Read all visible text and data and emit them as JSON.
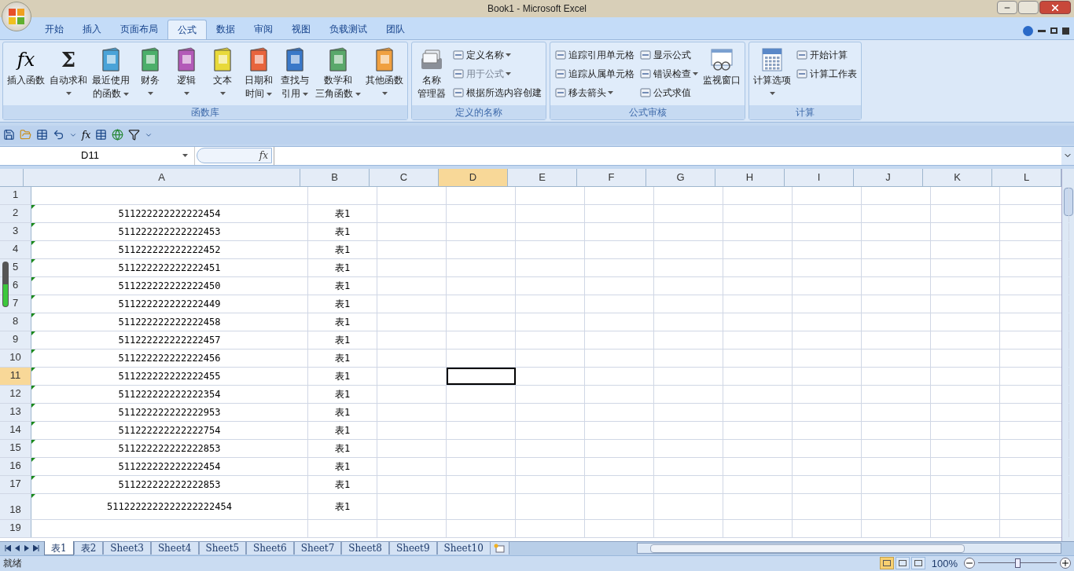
{
  "window": {
    "title": "Book1 - Microsoft Excel"
  },
  "tabs": [
    {
      "label": "开始",
      "selected": false
    },
    {
      "label": "插入",
      "selected": false
    },
    {
      "label": "页面布局",
      "selected": false
    },
    {
      "label": "公式",
      "selected": true
    },
    {
      "label": "数据",
      "selected": false
    },
    {
      "label": "审阅",
      "selected": false
    },
    {
      "label": "视图",
      "selected": false
    },
    {
      "label": "负载测试",
      "selected": false
    },
    {
      "label": "团队",
      "selected": false
    }
  ],
  "ribbon_groups": [
    {
      "label": "函数库",
      "items": [
        {
          "kind": "large",
          "glyph": "fx",
          "lines": [
            "插入函数"
          ],
          "dropdown": false
        },
        {
          "kind": "large",
          "glyph": "Σ",
          "lines": [
            "自动求和"
          ],
          "dropdown": true
        },
        {
          "kind": "large",
          "lines": [
            "最近使用",
            "的函数"
          ],
          "dropdown": true
        },
        {
          "kind": "large",
          "lines": [
            "财务"
          ],
          "dropdown": true
        },
        {
          "kind": "large",
          "lines": [
            "逻辑"
          ],
          "dropdown": true
        },
        {
          "kind": "large",
          "lines": [
            "文本"
          ],
          "dropdown": true
        },
        {
          "kind": "large",
          "lines": [
            "日期和",
            "时间"
          ],
          "dropdown": true
        },
        {
          "kind": "large",
          "lines": [
            "查找与",
            "引用"
          ],
          "dropdown": true
        },
        {
          "kind": "large",
          "lines": [
            "数学和",
            "三角函数"
          ],
          "dropdown": true
        },
        {
          "kind": "large",
          "lines": [
            "其他函数"
          ],
          "dropdown": true
        }
      ]
    },
    {
      "label": "定义的名称",
      "items": [
        {
          "kind": "large",
          "lines": [
            "名称",
            "管理器"
          ],
          "dropdown": false
        },
        {
          "kind": "stack",
          "entries": [
            {
              "label": "定义名称",
              "dropdown": true,
              "disabled": false
            },
            {
              "label": "用于公式",
              "dropdown": true,
              "disabled": true
            },
            {
              "label": "根据所选内容创建",
              "dropdown": false,
              "disabled": false
            }
          ]
        }
      ]
    },
    {
      "label": "公式审核",
      "items": [
        {
          "kind": "stack",
          "entries": [
            {
              "label": "追踪引用单元格",
              "dropdown": false,
              "disabled": false
            },
            {
              "label": "追踪从属单元格",
              "dropdown": false,
              "disabled": false
            },
            {
              "label": "移去箭头",
              "dropdown": true,
              "disabled": false
            }
          ]
        },
        {
          "kind": "stack",
          "entries": [
            {
              "label": "显示公式",
              "dropdown": false,
              "disabled": false
            },
            {
              "label": "错误检查",
              "dropdown": true,
              "disabled": false
            },
            {
              "label": "公式求值",
              "dropdown": false,
              "disabled": false
            }
          ]
        },
        {
          "kind": "large",
          "lines": [
            "监视窗口"
          ],
          "dropdown": false
        }
      ]
    },
    {
      "label": "计算",
      "items": [
        {
          "kind": "large",
          "lines": [
            "计算选项"
          ],
          "dropdown": true
        },
        {
          "kind": "stack",
          "entries": [
            {
              "label": "开始计算",
              "dropdown": false,
              "disabled": false
            },
            {
              "label": "计算工作表",
              "dropdown": false,
              "disabled": false
            }
          ]
        }
      ]
    }
  ],
  "name_box": {
    "value": "D11"
  },
  "quick_access": {
    "function_glyph": "fx"
  },
  "formula_bar": {
    "function_glyph": "fx"
  },
  "columns": [
    {
      "label": "A",
      "selected": false
    },
    {
      "label": "B",
      "selected": false
    },
    {
      "label": "C",
      "selected": false
    },
    {
      "label": "D",
      "selected": true
    },
    {
      "label": "E",
      "selected": false
    },
    {
      "label": "F",
      "selected": false
    },
    {
      "label": "G",
      "selected": false
    },
    {
      "label": "H",
      "selected": false
    },
    {
      "label": "I",
      "selected": false
    },
    {
      "label": "J",
      "selected": false
    },
    {
      "label": "K",
      "selected": false
    },
    {
      "label": "L",
      "selected": false
    }
  ],
  "rows": [
    {
      "label": "1",
      "selected": false,
      "error_flag": false,
      "cells": [
        "",
        ""
      ]
    },
    {
      "label": "2",
      "selected": false,
      "error_flag": true,
      "cells": [
        "511222222222222454",
        "表1"
      ]
    },
    {
      "label": "3",
      "selected": false,
      "error_flag": true,
      "cells": [
        "511222222222222453",
        "表1"
      ]
    },
    {
      "label": "4",
      "selected": false,
      "error_flag": true,
      "cells": [
        "511222222222222452",
        "表1"
      ]
    },
    {
      "label": "5",
      "selected": false,
      "error_flag": true,
      "cells": [
        "511222222222222451",
        "表1"
      ]
    },
    {
      "label": "6",
      "selected": false,
      "error_flag": true,
      "cells": [
        "511222222222222450",
        "表1"
      ]
    },
    {
      "label": "7",
      "selected": false,
      "error_flag": true,
      "cells": [
        "511222222222222449",
        "表1"
      ]
    },
    {
      "label": "8",
      "selected": false,
      "error_flag": true,
      "cells": [
        "511222222222222458",
        "表1"
      ]
    },
    {
      "label": "9",
      "selected": false,
      "error_flag": true,
      "cells": [
        "511222222222222457",
        "表1"
      ]
    },
    {
      "label": "10",
      "selected": false,
      "error_flag": true,
      "cells": [
        "511222222222222456",
        "表1"
      ]
    },
    {
      "label": "11",
      "selected": true,
      "error_flag": true,
      "cells": [
        "511222222222222455",
        "表1"
      ]
    },
    {
      "label": "12",
      "selected": false,
      "error_flag": true,
      "cells": [
        "511222222222222354",
        "表1"
      ]
    },
    {
      "label": "13",
      "selected": false,
      "error_flag": true,
      "cells": [
        "511222222222222953",
        "表1"
      ]
    },
    {
      "label": "14",
      "selected": false,
      "error_flag": true,
      "cells": [
        "511222222222222754",
        "表1"
      ]
    },
    {
      "label": "15",
      "selected": false,
      "error_flag": true,
      "cells": [
        "511222222222222853",
        "表1"
      ]
    },
    {
      "label": "16",
      "selected": false,
      "error_flag": true,
      "cells": [
        "511222222222222454",
        "表1"
      ]
    },
    {
      "label": "17",
      "selected": false,
      "error_flag": true,
      "cells": [
        "511222222222222853",
        "表1"
      ]
    },
    {
      "label": "18",
      "selected": false,
      "error_flag": true,
      "tall": true,
      "cells": [
        "5112222222222222222454",
        "表1"
      ]
    },
    {
      "label": "19",
      "selected": false,
      "error_flag": false,
      "cells": [
        "",
        ""
      ]
    }
  ],
  "sheet_tabs": [
    {
      "label": "表1",
      "selected": true
    },
    {
      "label": "表2",
      "selected": false
    },
    {
      "label": "Sheet3",
      "selected": false
    },
    {
      "label": "Sheet4",
      "selected": false
    },
    {
      "label": "Sheet5",
      "selected": false
    },
    {
      "label": "Sheet6",
      "selected": false
    },
    {
      "label": "Sheet7",
      "selected": false
    },
    {
      "label": "Sheet8",
      "selected": false
    },
    {
      "label": "Sheet9",
      "selected": false
    },
    {
      "label": "Sheet10",
      "selected": false
    }
  ],
  "status_bar": {
    "status": "就绪",
    "views": [
      {
        "selected": true
      },
      {
        "selected": false
      },
      {
        "selected": false
      }
    ],
    "zoom": "100%",
    "zoom_slider": {
      "level": 0.5
    }
  }
}
